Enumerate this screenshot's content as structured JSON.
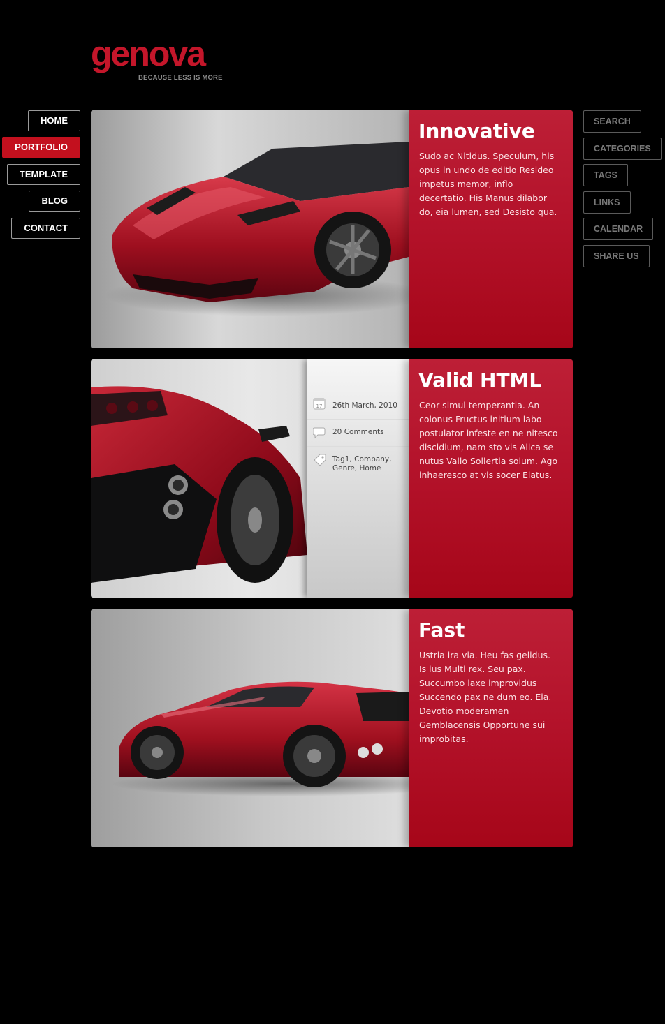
{
  "brand": {
    "name": "genova",
    "tagline": "BECAUSE LESS IS MORE",
    "accent_color": "#c3162a"
  },
  "nav": {
    "items": [
      {
        "label": "HOME",
        "active": false
      },
      {
        "label": "PORTFOLIO",
        "active": true
      },
      {
        "label": "TEMPLATE",
        "active": false
      },
      {
        "label": "BLOG",
        "active": false
      },
      {
        "label": "CONTACT",
        "active": false
      }
    ]
  },
  "sidebar": {
    "items": [
      {
        "label": "SEARCH"
      },
      {
        "label": "CATEGORIES"
      },
      {
        "label": "TAGS"
      },
      {
        "label": "LINKS"
      },
      {
        "label": "CALENDAR"
      },
      {
        "label": "SHARE US"
      }
    ]
  },
  "posts": [
    {
      "title": "Innovative",
      "body": "Sudo ac Nitidus. Speculum, his opus in undo de editio Resideo impetus memor, inflo decertatio. His Manus dilabor do, eia lumen, sed Desisto qua."
    },
    {
      "title": "Valid HTML",
      "body": "Ceor simul temperantia. An colonus Fructus initium labo postulator infeste en ne nitesco discidium, nam sto vis Alica se nutus Vallo Sollertia solum. Ago inhaeresco at vis socer Elatus.",
      "meta": {
        "date": "26th March, 2010",
        "calendar_day": "17",
        "comments": "20 Comments",
        "tags": "Tag1, Company, Genre, Home"
      }
    },
    {
      "title": "Fast",
      "body": "Ustria ira via. Heu fas gelidus. Is ius Multi rex. Seu pax. Succumbo laxe improvidus Succendo pax ne dum eo. Eia. Devotio moderamen Gemblacensis Opportune sui improbitas."
    }
  ]
}
